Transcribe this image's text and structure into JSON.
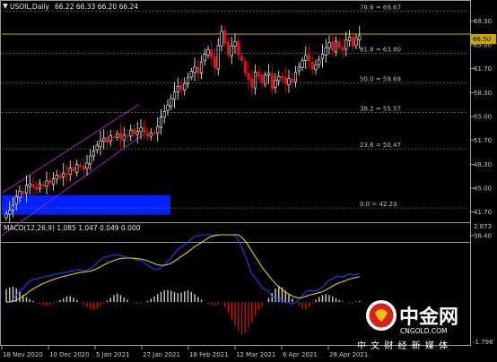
{
  "header": {
    "symbol_label": "USOIL,Daily",
    "ohlc": "66.22 66.33 66.20 66.24",
    "menu_glyph": "▼"
  },
  "price_axis": {
    "ticks": [
      "68.30",
      "65.00",
      "61.70",
      "58.30",
      "55.00",
      "51.70",
      "48.30",
      "45.00",
      "41.70",
      "38.40"
    ],
    "current_price": "66.50"
  },
  "time_axis": {
    "ticks": [
      "18 Nov 2020",
      "10 Dec 2020",
      "5 Jan 2021",
      "27 Jan 2021",
      "18 Feb 2021",
      "12 Mar 2021",
      "6 Apr 2021",
      "28 Apr 2021"
    ]
  },
  "fibonacci": {
    "levels": [
      {
        "label": "78.6 = 69.67",
        "price": 69.67
      },
      {
        "label": "61.8 = 63.80",
        "price": 63.8
      },
      {
        "label": "50.0 = 59.69",
        "price": 59.69
      },
      {
        "label": "38.2 = 55.57",
        "price": 55.57
      },
      {
        "label": "23.6 = 50.47",
        "price": 50.47
      },
      {
        "label": "0.0 = 42.23",
        "price": 42.23
      }
    ]
  },
  "macd": {
    "label": "MACD(12,26,9) 1.085 1.047 0.049 0.000",
    "axis_top": "2.873",
    "axis_bottom": "-1.796"
  },
  "watermark": {
    "cn": "中金网",
    "en": "CNGOLD.COM",
    "sub": "中 文 财 经 新 媒 体"
  },
  "colors": {
    "background": "#000000",
    "bull": "#ffffff",
    "bear": "#e01010",
    "hline": "#c8a800",
    "channel": "#a020c0",
    "zone": "#0020ff",
    "macd_main": "#2040ff",
    "macd_signal": "#e0d000",
    "hist_pos": "#d0d0d0",
    "hist_neg": "#d01010"
  },
  "chart_data": {
    "type": "candlestick",
    "symbol": "USOIL",
    "timeframe": "Daily",
    "ylim": [
      37.5,
      71.0
    ],
    "horizontal_line": 66.5,
    "closes": [
      41.4,
      41.9,
      42.6,
      43.8,
      44.6,
      44.2,
      45.4,
      45.6,
      45.1,
      44.8,
      45.6,
      45.3,
      46.0,
      45.7,
      46.3,
      46.8,
      46.4,
      47.1,
      46.9,
      47.8,
      47.4,
      48.3,
      48.0,
      47.6,
      48.5,
      49.5,
      50.2,
      51.0,
      51.6,
      52.0,
      51.4,
      52.3,
      52.1,
      52.6,
      51.9,
      52.4,
      52.2,
      53.1,
      52.6,
      52.9,
      53.4,
      52.8,
      52.3,
      52.7,
      52.5,
      53.6,
      54.9,
      55.7,
      56.6,
      57.5,
      58.4,
      59.2,
      58.8,
      59.6,
      60.4,
      61.3,
      61.9,
      61.0,
      62.6,
      63.7,
      64.3,
      63.2,
      61.8,
      64.9,
      66.9,
      65.2,
      63.6,
      64.8,
      65.4,
      63.6,
      62.8,
      61.0,
      60.1,
      59.1,
      61.2,
      60.6,
      59.7,
      60.8,
      61.0,
      58.9,
      60.1,
      60.6,
      60.4,
      59.6,
      60.3,
      59.8,
      61.2,
      61.9,
      62.8,
      63.5,
      62.8,
      61.6,
      62.2,
      62.9,
      63.7,
      64.6,
      65.3,
      64.2,
      65.5,
      64.6,
      64.2,
      65.7,
      66.1,
      64.8,
      65.9,
      66.24
    ],
    "macd_hist": [
      0.55,
      0.62,
      0.66,
      0.58,
      0.44,
      0.3,
      0.2,
      0.12,
      0.05,
      -0.04,
      -0.1,
      -0.14,
      -0.16,
      -0.12,
      -0.06,
      0.02,
      0.08,
      0.16,
      0.24,
      0.26,
      0.18,
      0.08,
      -0.04,
      -0.14,
      -0.22,
      -0.3,
      -0.34,
      -0.28,
      -0.18,
      -0.06,
      0.06,
      0.18,
      0.3,
      0.36,
      0.3,
      0.2,
      0.1,
      0.0,
      -0.06,
      -0.1,
      -0.06,
      -0.02,
      0.05,
      0.14,
      0.24,
      0.34,
      0.44,
      0.5,
      0.52,
      0.48,
      0.42,
      0.38,
      0.4,
      0.46,
      0.5,
      0.44,
      0.34,
      0.22,
      0.1,
      0.0,
      -0.08,
      -0.12,
      -0.16,
      -0.12,
      -0.04,
      -0.2,
      -0.46,
      -0.76,
      -1.02,
      -1.24,
      -1.4,
      -1.3,
      -1.1,
      -0.86,
      -0.58,
      -0.34,
      -0.16,
      0.0,
      0.18,
      0.38,
      0.58,
      0.7,
      0.62,
      0.48,
      0.32,
      0.14,
      -0.02,
      -0.16,
      -0.26,
      -0.3,
      -0.2,
      -0.06,
      0.1,
      0.22,
      0.3,
      0.34,
      0.3,
      0.24,
      0.16,
      0.08,
      0.02,
      -0.04,
      -0.08,
      -0.06,
      0.02,
      0.05
    ]
  }
}
